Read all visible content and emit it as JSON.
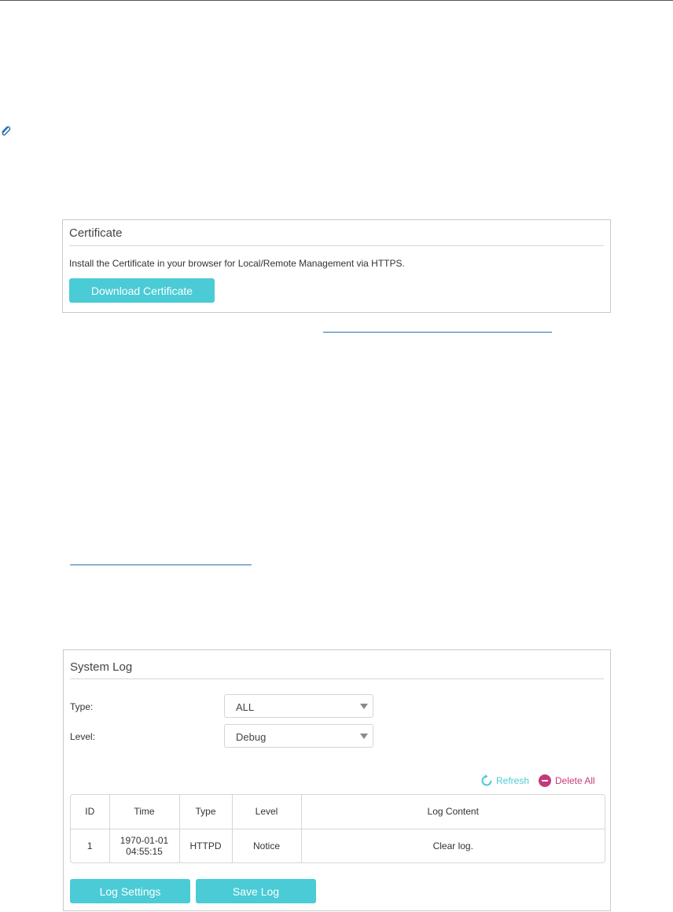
{
  "certificate": {
    "title": "Certificate",
    "description": "Install the Certificate in your browser for Local/Remote Management via HTTPS.",
    "download_label": "Download Certificate"
  },
  "system_log": {
    "title": "System Log",
    "type_label": "Type:",
    "type_value": "ALL",
    "level_label": "Level:",
    "level_value": "Debug",
    "refresh_label": "Refresh",
    "delete_all_label": "Delete All",
    "columns": [
      "ID",
      "Time",
      "Type",
      "Level",
      "Log Content"
    ],
    "rows": [
      {
        "id": "1",
        "time": "1970-01-01 04:55:15",
        "type": "HTTPD",
        "level": "Notice",
        "content": "Clear log."
      }
    ],
    "log_settings_label": "Log Settings",
    "save_log_label": "Save Log"
  },
  "colors": {
    "accent": "#4acbd6",
    "delete": "#c23a7a",
    "link": "#2a6fb0"
  }
}
